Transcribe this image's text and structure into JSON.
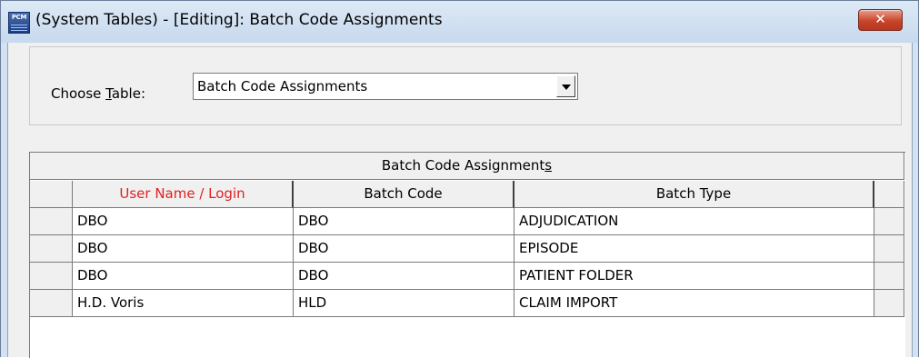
{
  "window": {
    "app_icon": "pcm-logo-icon",
    "app_icon_text": "PCM",
    "title": "(System Tables) - [Editing]:  Batch Code Assignments",
    "close_glyph": "✕"
  },
  "chooser": {
    "label_prefix": "Choose ",
    "label_accel": "T",
    "label_suffix": "able:",
    "selected_value": "Batch Code Assignments"
  },
  "grid": {
    "title_main": "Batch Code Assignment",
    "title_accel": "s",
    "columns": [
      "User Name / Login",
      "Batch Code",
      "Batch Type"
    ],
    "rows": [
      {
        "user": "DBO",
        "code": "DBO",
        "type": "ADJUDICATION"
      },
      {
        "user": "DBO",
        "code": "DBO",
        "type": "EPISODE"
      },
      {
        "user": "DBO",
        "code": "DBO",
        "type": "PATIENT FOLDER"
      },
      {
        "user": "H.D. Voris",
        "code": "HLD",
        "type": "CLAIM IMPORT"
      }
    ]
  },
  "colors": {
    "required_column_header": "#e02020",
    "close_button": "#c9442a"
  }
}
